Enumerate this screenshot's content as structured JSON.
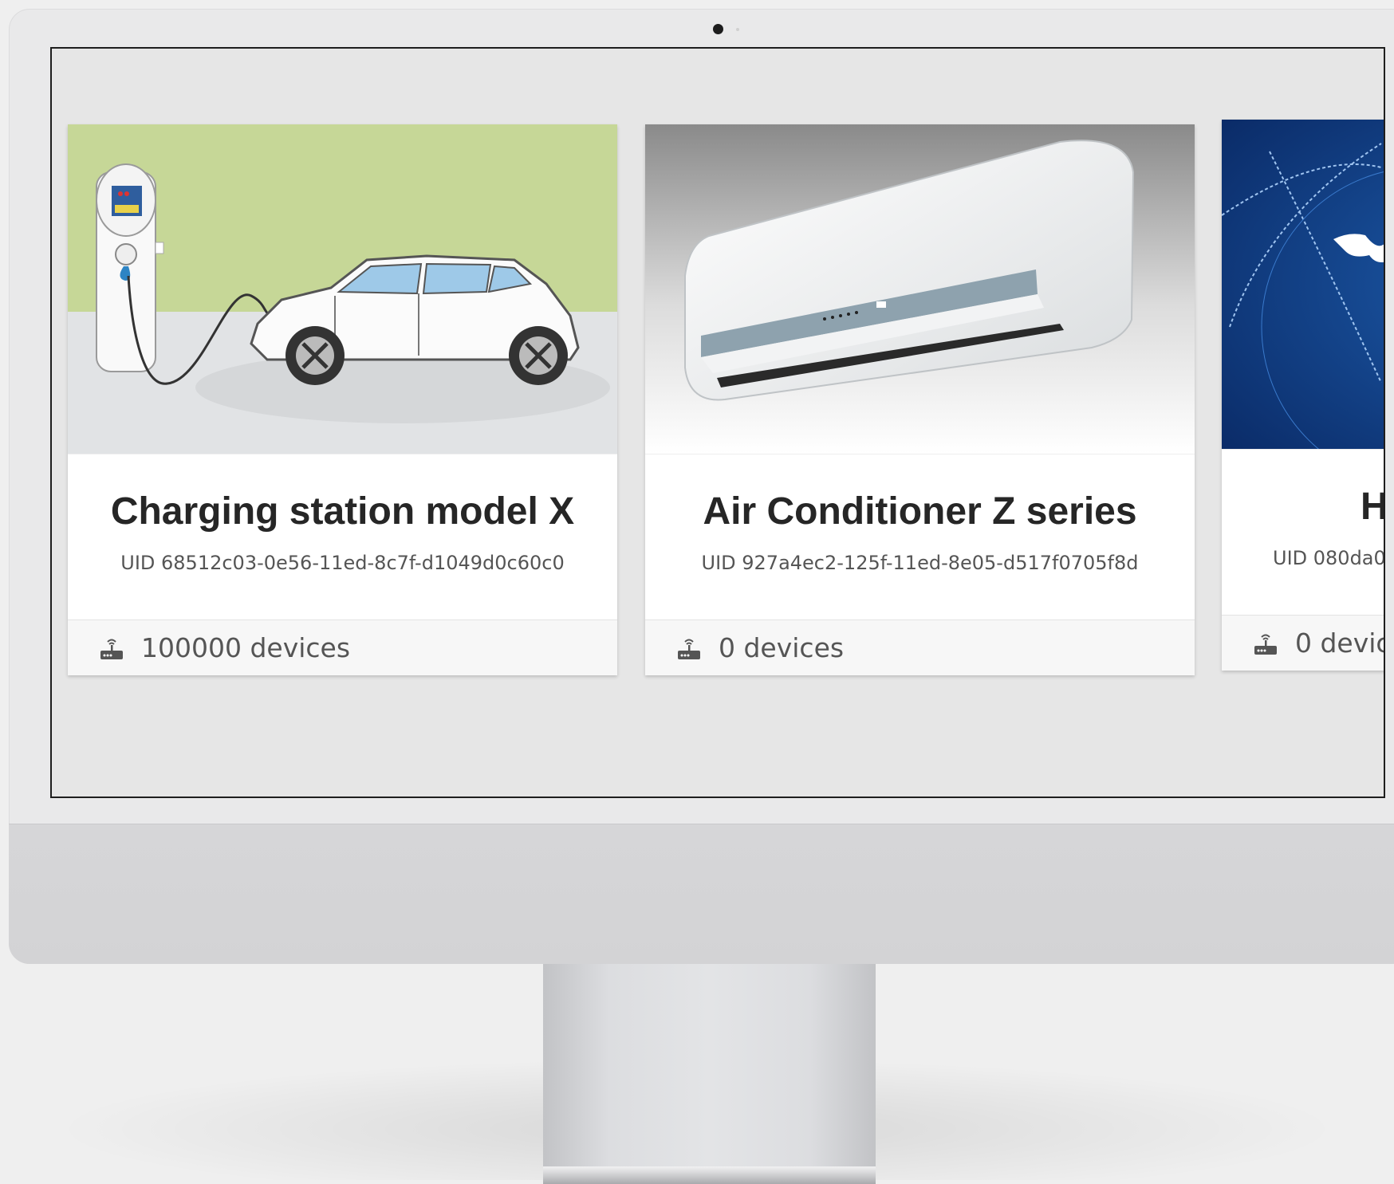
{
  "cards": [
    {
      "title": "Charging station model X",
      "uid": "UID 68512c03-0e56-11ed-8c7f-d1049d0c60c0",
      "devices": "100000 devices",
      "image": "electric-car-charging-image"
    },
    {
      "title": "Air Conditioner Z series",
      "uid": "UID 927a4ec2-125f-11ed-8e05-d517f0705f8d",
      "devices": "0 devices",
      "image": "air-conditioner-image"
    },
    {
      "title": "H",
      "uid": "UID 080da0",
      "devices": "0 devic",
      "image": "globe-network-image"
    }
  ],
  "icons": {
    "device": "router-icon"
  }
}
